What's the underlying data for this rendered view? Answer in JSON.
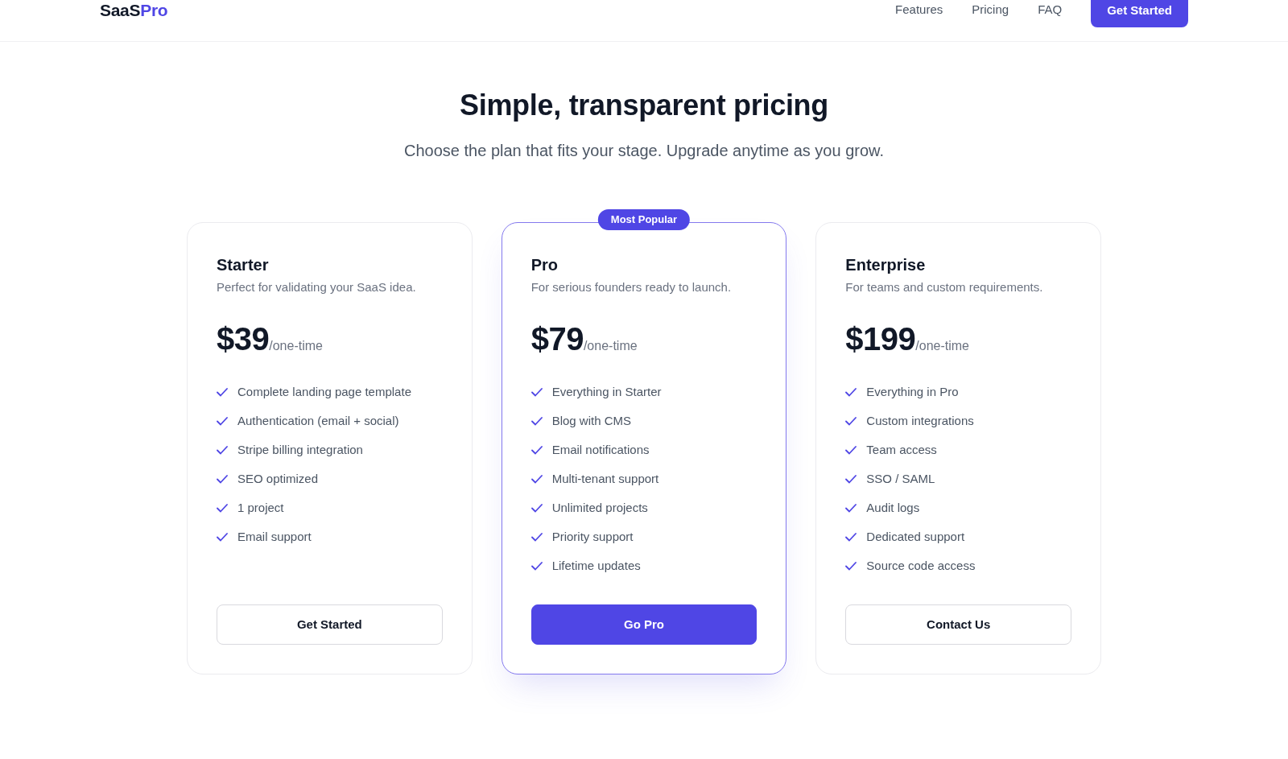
{
  "header": {
    "logo": {
      "name": "SaaS",
      "suffix": "Pro"
    },
    "nav": [
      {
        "label": "Features"
      },
      {
        "label": "Pricing"
      },
      {
        "label": "FAQ"
      }
    ],
    "cta": "Get Started"
  },
  "hero": {
    "title": "Simple, transparent pricing",
    "subtitle": "Choose the plan that fits your stage. Upgrade anytime as you grow."
  },
  "plans": [
    {
      "name": "Starter",
      "description": "Perfect for validating your SaaS idea.",
      "price": "$39",
      "period": "/one-time",
      "featured": false,
      "features": [
        "Complete landing page template",
        "Authentication (email + social)",
        "Stripe billing integration",
        "SEO optimized",
        "1 project",
        "Email support"
      ],
      "button": {
        "label": "Get Started",
        "kind": "outline"
      }
    },
    {
      "name": "Pro",
      "badge": "Most Popular",
      "description": "For serious founders ready to launch.",
      "price": "$79",
      "period": "/one-time",
      "featured": true,
      "features": [
        "Everything in Starter",
        "Blog with CMS",
        "Email notifications",
        "Multi-tenant support",
        "Unlimited projects",
        "Priority support",
        "Lifetime updates"
      ],
      "button": {
        "label": "Go Pro",
        "kind": "primary"
      }
    },
    {
      "name": "Enterprise",
      "description": "For teams and custom requirements.",
      "price": "$199",
      "period": "/one-time",
      "featured": false,
      "features": [
        "Everything in Pro",
        "Custom integrations",
        "Team access",
        "SSO / SAML",
        "Audit logs",
        "Dedicated support",
        "Source code access"
      ],
      "button": {
        "label": "Contact Us",
        "kind": "outline"
      }
    }
  ]
}
